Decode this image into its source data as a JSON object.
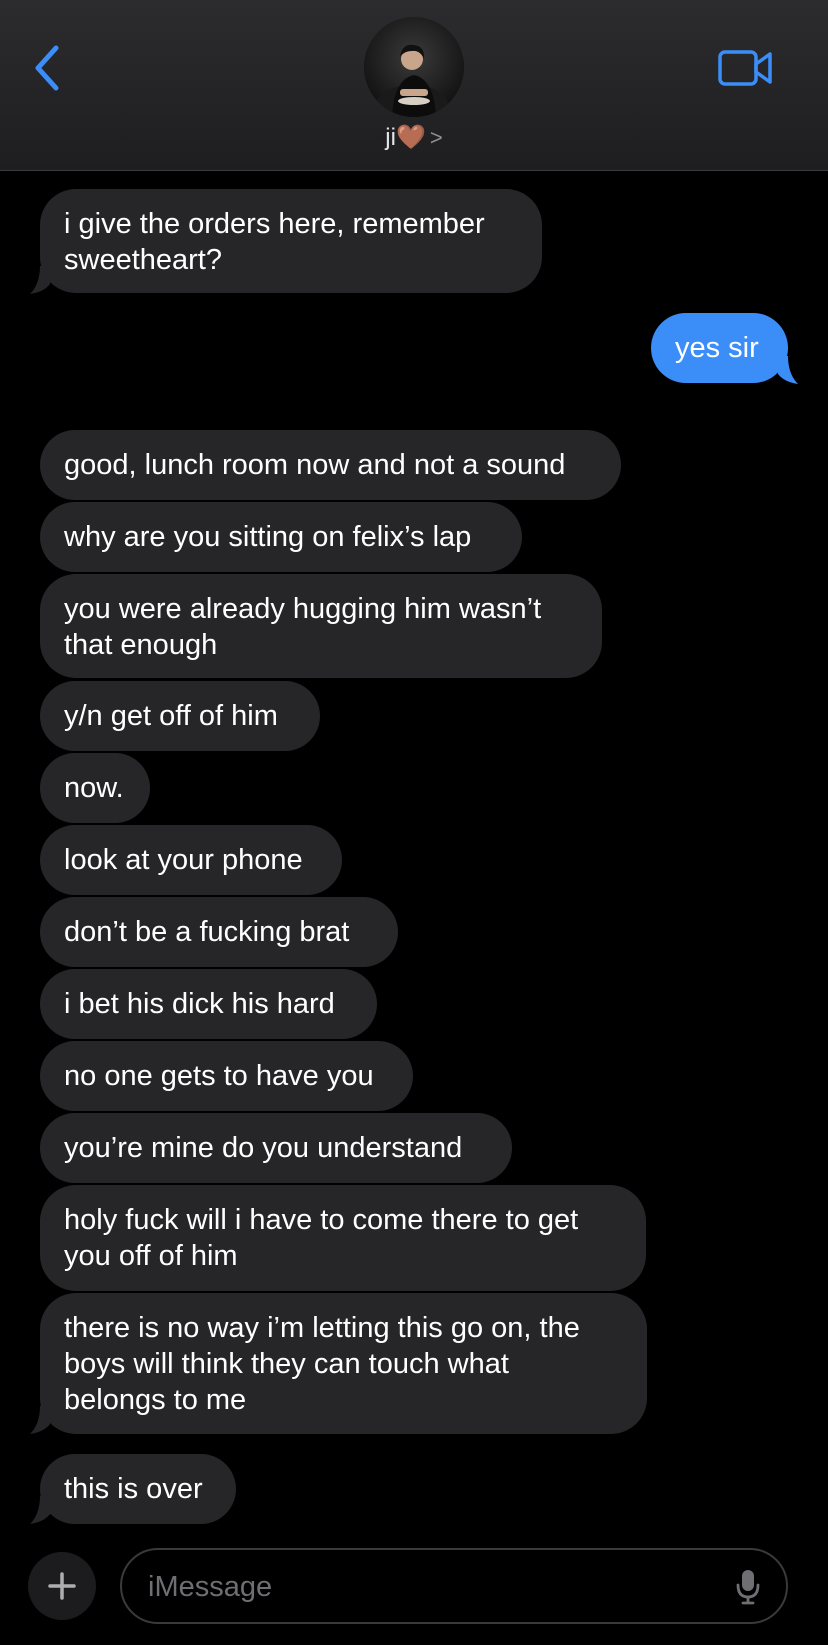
{
  "colors": {
    "accent": "#3b8df8",
    "incoming_bubble": "#262629",
    "outgoing_bubble": "#3b8df8",
    "background": "#000000"
  },
  "header": {
    "back_icon": "chevron-left-icon",
    "contact_name": "ji🤎",
    "contact_chevron": ">",
    "video_icon": "video-camera-icon"
  },
  "messages": [
    {
      "from": "contact",
      "text": "i give the orders here, remember\nsweetheart?"
    },
    {
      "from": "me",
      "text": "yes sir"
    },
    {
      "from": "contact",
      "text": "good, lunch room now and not a sound"
    },
    {
      "from": "contact",
      "text": "why are you sitting on felix’s lap"
    },
    {
      "from": "contact",
      "text": "you were already hugging him wasn’t\nthat enough"
    },
    {
      "from": "contact",
      "text": "y/n get off of him"
    },
    {
      "from": "contact",
      "text": "now."
    },
    {
      "from": "contact",
      "text": "look at your phone"
    },
    {
      "from": "contact",
      "text": "don’t be a fucking brat"
    },
    {
      "from": "contact",
      "text": "i bet his dick his hard"
    },
    {
      "from": "contact",
      "text": "no one gets to have you"
    },
    {
      "from": "contact",
      "text": "you’re mine do you understand"
    },
    {
      "from": "contact",
      "text": "holy fuck will i have to come there to get\nyou off of him"
    },
    {
      "from": "contact",
      "text": "there is no way i’m letting this go on, the\nboys will think they can touch what\nbelongs to me"
    },
    {
      "from": "contact",
      "text": "this is over"
    }
  ],
  "composer": {
    "plus_icon": "plus-icon",
    "placeholder": "iMessage",
    "value": "",
    "mic_icon": "microphone-icon"
  }
}
